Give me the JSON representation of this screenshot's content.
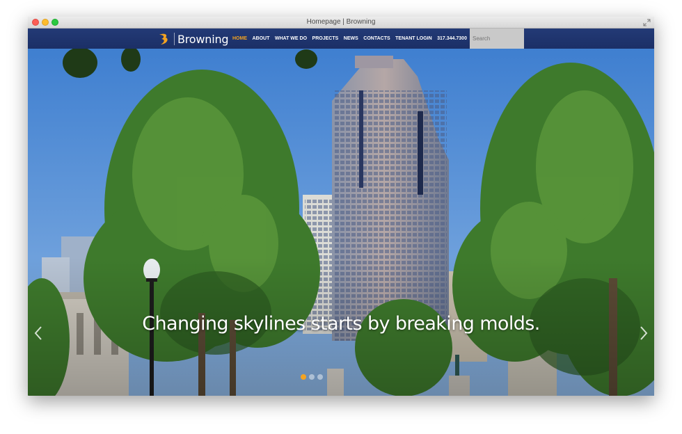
{
  "window": {
    "title": "Homepage | Browning"
  },
  "header": {
    "logo_text": "Browning",
    "menu": [
      {
        "label": "HOME",
        "active": true
      },
      {
        "label": "ABOUT",
        "active": false
      },
      {
        "label": "WHAT WE DO",
        "active": false
      },
      {
        "label": "PROJECTS",
        "active": false
      },
      {
        "label": "NEWS",
        "active": false
      },
      {
        "label": "CONTACTS",
        "active": false
      },
      {
        "label": "TENANT LOGIN",
        "active": false
      },
      {
        "label": "317.344.7300",
        "active": false
      }
    ],
    "search_placeholder": "Search"
  },
  "hero": {
    "caption": "Changing skylines starts by breaking molds.",
    "slide_count": 3,
    "active_slide": 1
  },
  "colors": {
    "nav_bg": "#1f3470",
    "accent": "#f3a321",
    "search_bg": "#c9c9c9"
  },
  "icons": {
    "window_fullscreen": "fullscreen-icon",
    "logo_mark": "browning-b-logo-icon",
    "prev": "chevron-left-icon",
    "next": "chevron-right-icon"
  }
}
